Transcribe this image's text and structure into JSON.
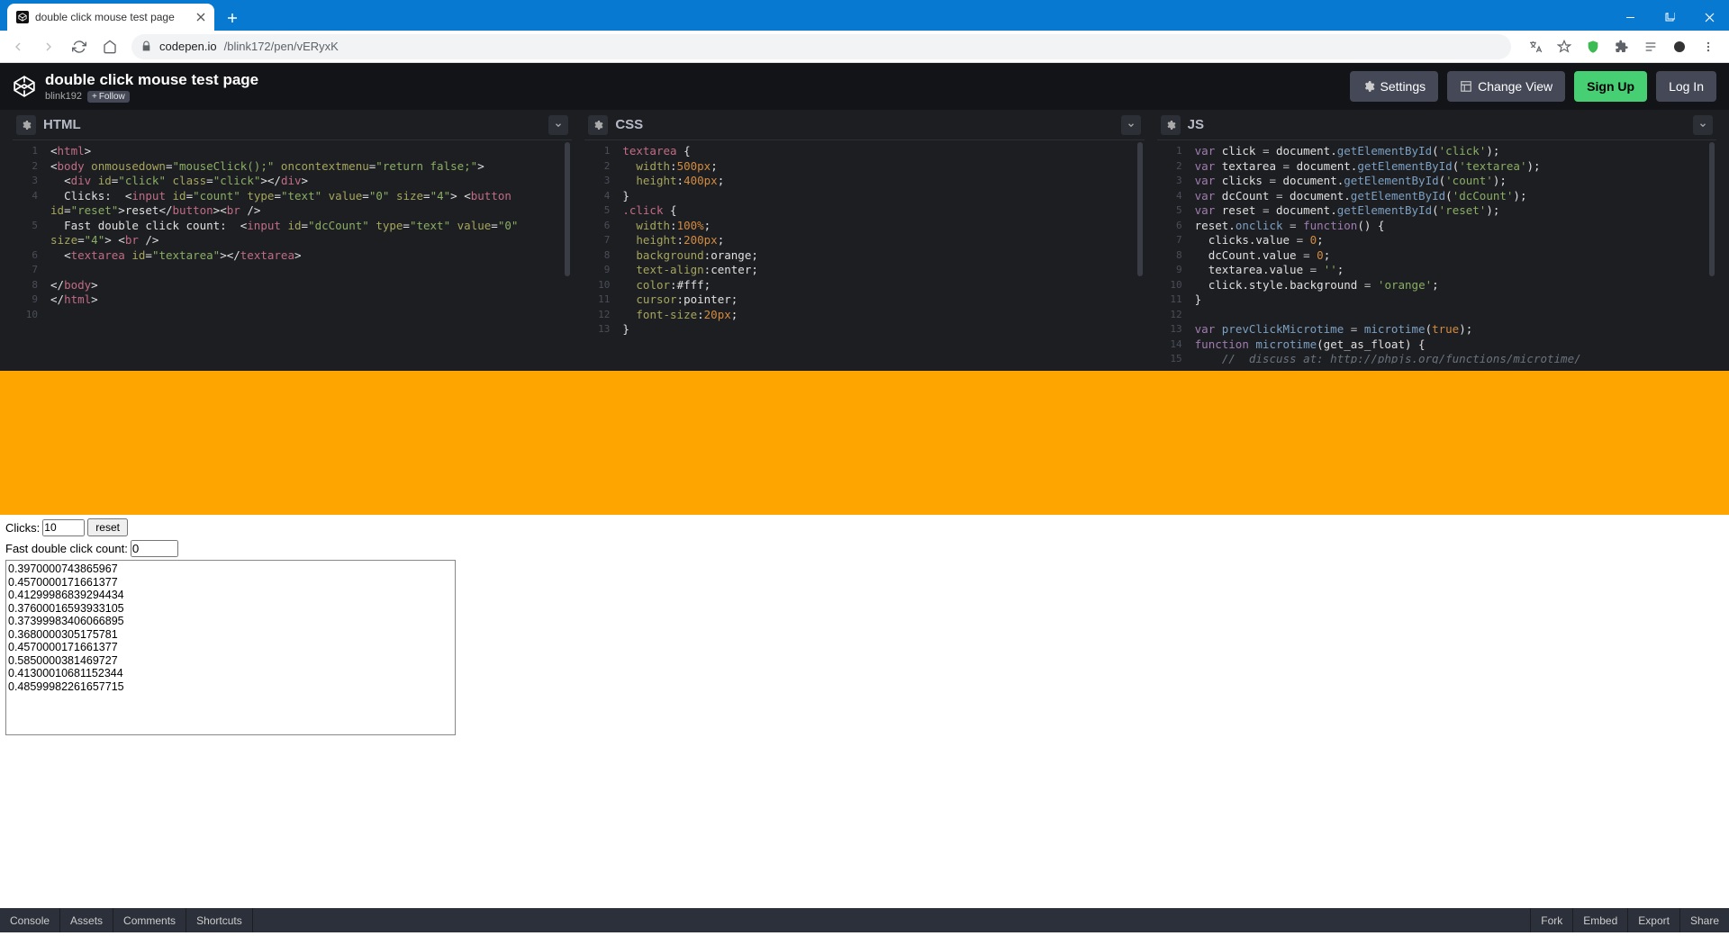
{
  "browser": {
    "tab_title": "double click mouse test page",
    "url_host": "codepen.io",
    "url_path": "/blink172/pen/vERyxK"
  },
  "codepen_header": {
    "pen_title": "double click mouse test page",
    "author": "blink192",
    "follow_label": "Follow",
    "settings": "Settings",
    "change_view": "Change View",
    "signup": "Sign Up",
    "login": "Log In"
  },
  "editors": {
    "html": {
      "title": "HTML"
    },
    "css": {
      "title": "CSS"
    },
    "js": {
      "title": "JS"
    }
  },
  "result": {
    "clicks_label": "Clicks:",
    "clicks_value": "10",
    "reset_label": "reset",
    "dc_label": "Fast double click count:",
    "dc_value": "0",
    "textarea_value": "0.3970000743865967\n0.4570000171661377\n0.41299986839294434\n0.37600016593933105\n0.37399983406066895\n0.3680000305175781\n0.4570000171661377\n0.5850000381469727\n0.41300010681152344\n0.48599982261657715"
  },
  "footer": {
    "console": "Console",
    "assets": "Assets",
    "comments": "Comments",
    "shortcuts": "Shortcuts",
    "fork": "Fork",
    "embed": "Embed",
    "export": "Export",
    "share": "Share"
  },
  "code": {
    "html_gutter": [
      "1",
      "2",
      "3",
      "4",
      "",
      "5",
      "",
      "6",
      "7",
      "8",
      "9",
      "10"
    ],
    "css_gutter": [
      "1",
      "2",
      "3",
      "4",
      "5",
      "6",
      "7",
      "8",
      "9",
      "10",
      "11",
      "12",
      "13"
    ],
    "js_gutter": [
      "1",
      "2",
      "3",
      "4",
      "5",
      "6",
      "7",
      "8",
      "9",
      "10",
      "11",
      "12",
      "13",
      "14",
      "15"
    ]
  }
}
